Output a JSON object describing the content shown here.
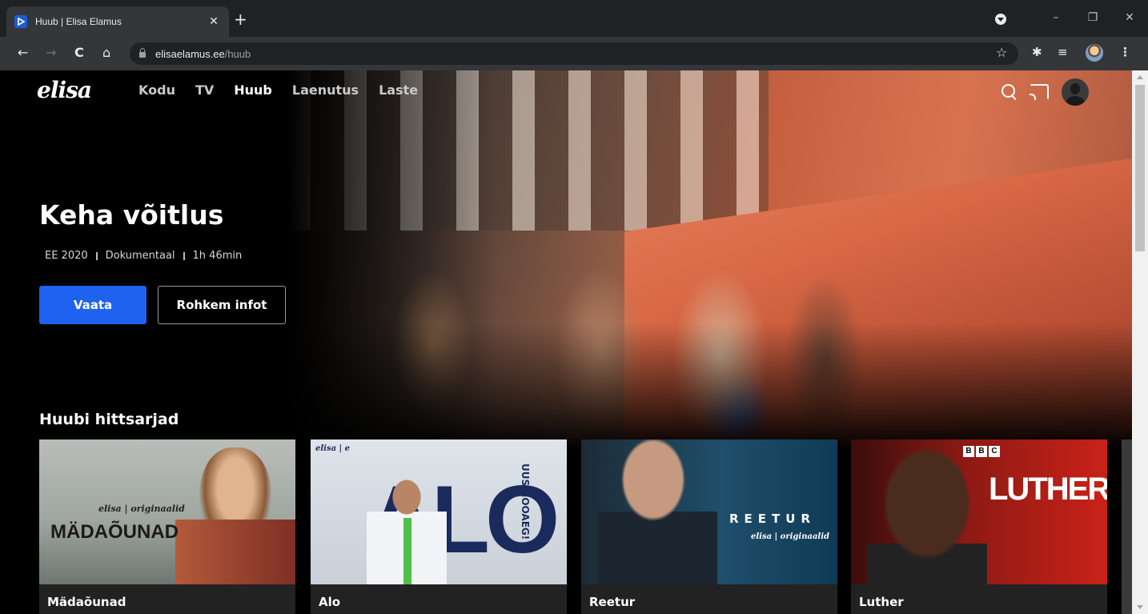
{
  "browser": {
    "tab_title": "Huub | Elisa Elamus",
    "tab_close": "✕",
    "new_tab": "+",
    "url_host": "elisaelamus.ee",
    "url_path": "/huub",
    "window_controls": {
      "minimize": "–",
      "restore": "❐",
      "close": "✕"
    },
    "nav": {
      "back": "←",
      "forward": "→",
      "reload": "C",
      "home": "⌂"
    },
    "icons": {
      "star": "☆",
      "extensions": "✱",
      "reading_list": "≡"
    }
  },
  "site": {
    "logo": "elisa",
    "nav": [
      {
        "label": "Kodu",
        "active": false
      },
      {
        "label": "TV",
        "active": false
      },
      {
        "label": "Huub",
        "active": true
      },
      {
        "label": "Laenutus",
        "active": false
      },
      {
        "label": "Laste",
        "active": false
      }
    ]
  },
  "hero": {
    "title": "Keha võitlus",
    "meta": [
      "EE 2020",
      "Dokumentaal",
      "1h 46min"
    ],
    "primary_button": "Vaata",
    "secondary_button": "Rohkem infot"
  },
  "row": {
    "title": "Huubi hittsarjad",
    "cards": [
      {
        "label": "Mädaõunad",
        "art_title": "MÄDAÕUNAD",
        "art_brand": "elisa | originaalid"
      },
      {
        "label": "Alo",
        "art_title": "ALO",
        "art_side": "UUS HOOAEG!",
        "art_brand": "elisa | e"
      },
      {
        "label": "Reetur",
        "art_title": "REETUR",
        "art_brand": "elisa | originaalid"
      },
      {
        "label": "Luther",
        "art_title": "LUTHER",
        "art_brand": [
          "B",
          "B",
          "C"
        ]
      }
    ]
  }
}
